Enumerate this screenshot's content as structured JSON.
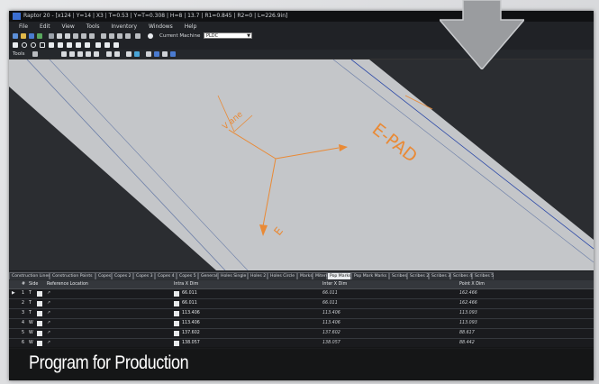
{
  "window": {
    "title": "Raptor 20 - [x124 | Y=14 | X3 | T=0.53 | Y=T=0.308 | H=8 | 13.7 | R1=0.845 | R2=0 | L=226.9in]",
    "menu": [
      "File",
      "Edit",
      "View",
      "Tools",
      "Inventory",
      "Windows",
      "Help"
    ]
  },
  "toolbar": {
    "machine_label": "Current Machine",
    "machine_value": "PLDC",
    "tools_label": "Tools"
  },
  "canvas": {
    "labels": [
      "V ane",
      "E-PAD",
      "E"
    ]
  },
  "tabs": [
    "Construction Lines",
    "Construction Points",
    "Copes 1",
    "Copes 2",
    "Copes 3",
    "Copes 4",
    "Copes 5",
    "General",
    "Holes Single",
    "Holes 2",
    "Holes Circle",
    "Marks",
    "Miters",
    "Pop Marks",
    "Pop Mark Marks",
    "Scribes",
    "Scribes 2",
    "Scribes 3",
    "Scribes 4",
    "Scribes 5"
  ],
  "active_tab": "Pop Marks",
  "grid": {
    "columns": [
      "#",
      "Side",
      "Reference Location",
      "Intra X Dim",
      "Inter X Dim",
      "Point X Dim"
    ],
    "rows": [
      {
        "num": "1",
        "side": "T",
        "ref": "↗",
        "intra": "66.011",
        "inter": "66.011",
        "point": "162.466"
      },
      {
        "num": "2",
        "side": "T",
        "ref": "↗",
        "intra": "66.011",
        "inter": "66.011",
        "point": "162.466"
      },
      {
        "num": "3",
        "side": "T",
        "ref": "↗",
        "intra": "113.406",
        "inter": "113.406",
        "point": "113.093"
      },
      {
        "num": "4",
        "side": "W",
        "ref": "↗",
        "intra": "113.406",
        "inter": "113.406",
        "point": "113.093"
      },
      {
        "num": "5",
        "side": "W",
        "ref": "↗",
        "intra": "137.602",
        "inter": "137.602",
        "point": "88.617"
      },
      {
        "num": "6",
        "side": "W",
        "ref": "↗",
        "intra": "138.057",
        "inter": "138.057",
        "point": "88.442"
      }
    ]
  },
  "banner": "Program for Production",
  "colors": {
    "accent": "#e98a36",
    "plate": "#c4c6c9",
    "line": "#2d4aa8"
  }
}
